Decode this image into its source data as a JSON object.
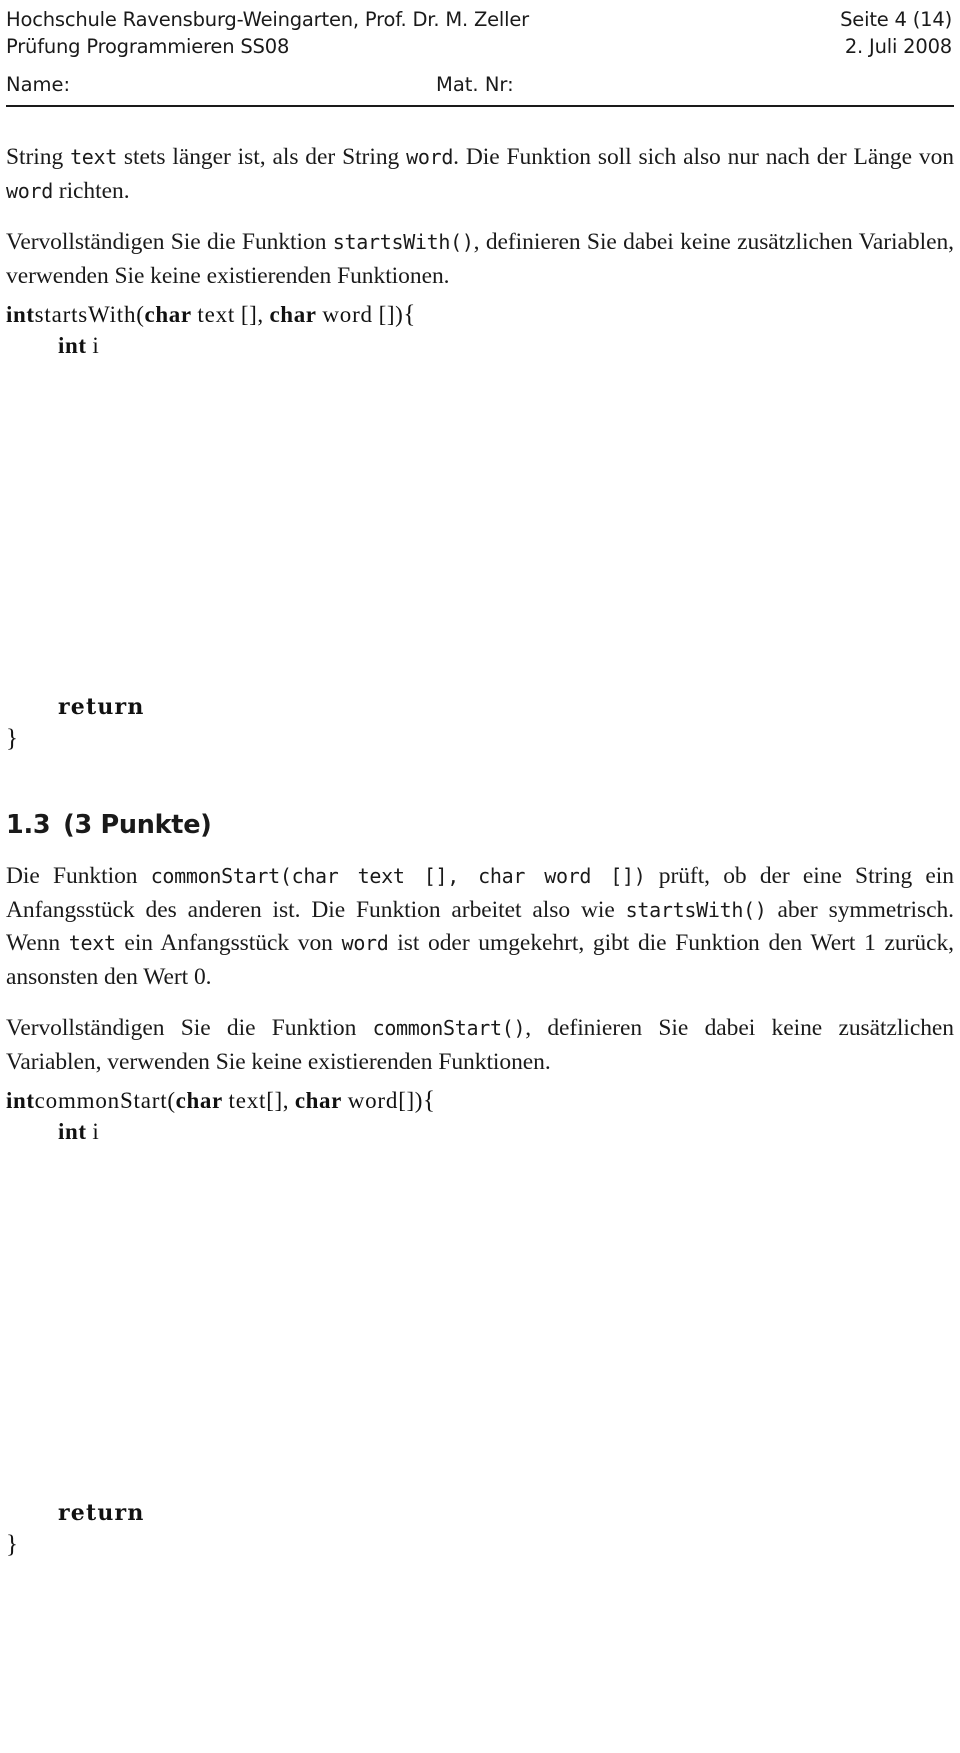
{
  "header": {
    "institution_line": "Hochschule Ravensburg-Weingarten, Prof. Dr. M. Zeller",
    "exam_line": "Prüfung Programmieren SS08",
    "page_label": "Seite 4 (14)",
    "date": "2. Juli 2008",
    "name_label": "Name:",
    "matnr_label": "Mat. Nr:"
  },
  "body": {
    "para1": {
      "part1": "String ",
      "code1": "text",
      "part2": " stets länger ist, als der String ",
      "code2": "word",
      "part3": ". Die Funktion soll sich also nur nach der Länge von ",
      "code3": "word",
      "part4": " richten."
    },
    "para2": {
      "part1": "Vervollständigen Sie die Funktion ",
      "code1": "startsWith()",
      "part2": ", definieren Sie dabei keine zusätzlichen Variablen, verwenden Sie keine existierenden Funktionen."
    }
  },
  "listing1": {
    "line1": {
      "kw1": "int",
      "name": "startsWith",
      "paren_open": "(",
      "kw2": "char",
      "param1": "text",
      "brackets1": "[]",
      "comma": ",",
      "kw3": "char",
      "param2": "word",
      "brackets2": "[]",
      "paren_close": ")",
      "brace_open": "{"
    },
    "line2": {
      "kw1": "int",
      "var": "i"
    },
    "line_return": "return",
    "line_close": "}"
  },
  "section": {
    "number": "1.3",
    "title": "(3 Punkte)"
  },
  "body2": {
    "para1": {
      "part1": "Die Funktion ",
      "code1": "commonStart(char text [], char word [])",
      "part2": " prüft, ob der eine String ein Anfangsstück des anderen ist. Die Funktion arbeitet also wie ",
      "code2": "startsWith()",
      "part3": " aber symmetrisch. Wenn ",
      "code3": "text",
      "part4": " ein Anfangsstück von ",
      "code4": "word",
      "part5": " ist oder umgekehrt, gibt die Funktion den Wert 1 zurück, ansonsten den Wert 0."
    },
    "para2": {
      "part1": "Vervollständigen Sie die Funktion ",
      "code1": "commonStart()",
      "part2": ", definieren Sie dabei keine zusätzlichen Variablen, verwenden Sie keine existierenden Funktionen."
    }
  },
  "listing2": {
    "line1": {
      "kw1": "int",
      "name": "commonStart",
      "paren_open": "(",
      "kw2": "char",
      "param1": "text",
      "brackets1": "[]",
      "comma": ",",
      "kw3": "char",
      "param2": "word",
      "brackets2": "[]",
      "paren_close": ")",
      "brace_open": "{"
    },
    "line2": {
      "kw1": "int",
      "var": "i"
    },
    "line_return": "return",
    "line_close": "}"
  }
}
